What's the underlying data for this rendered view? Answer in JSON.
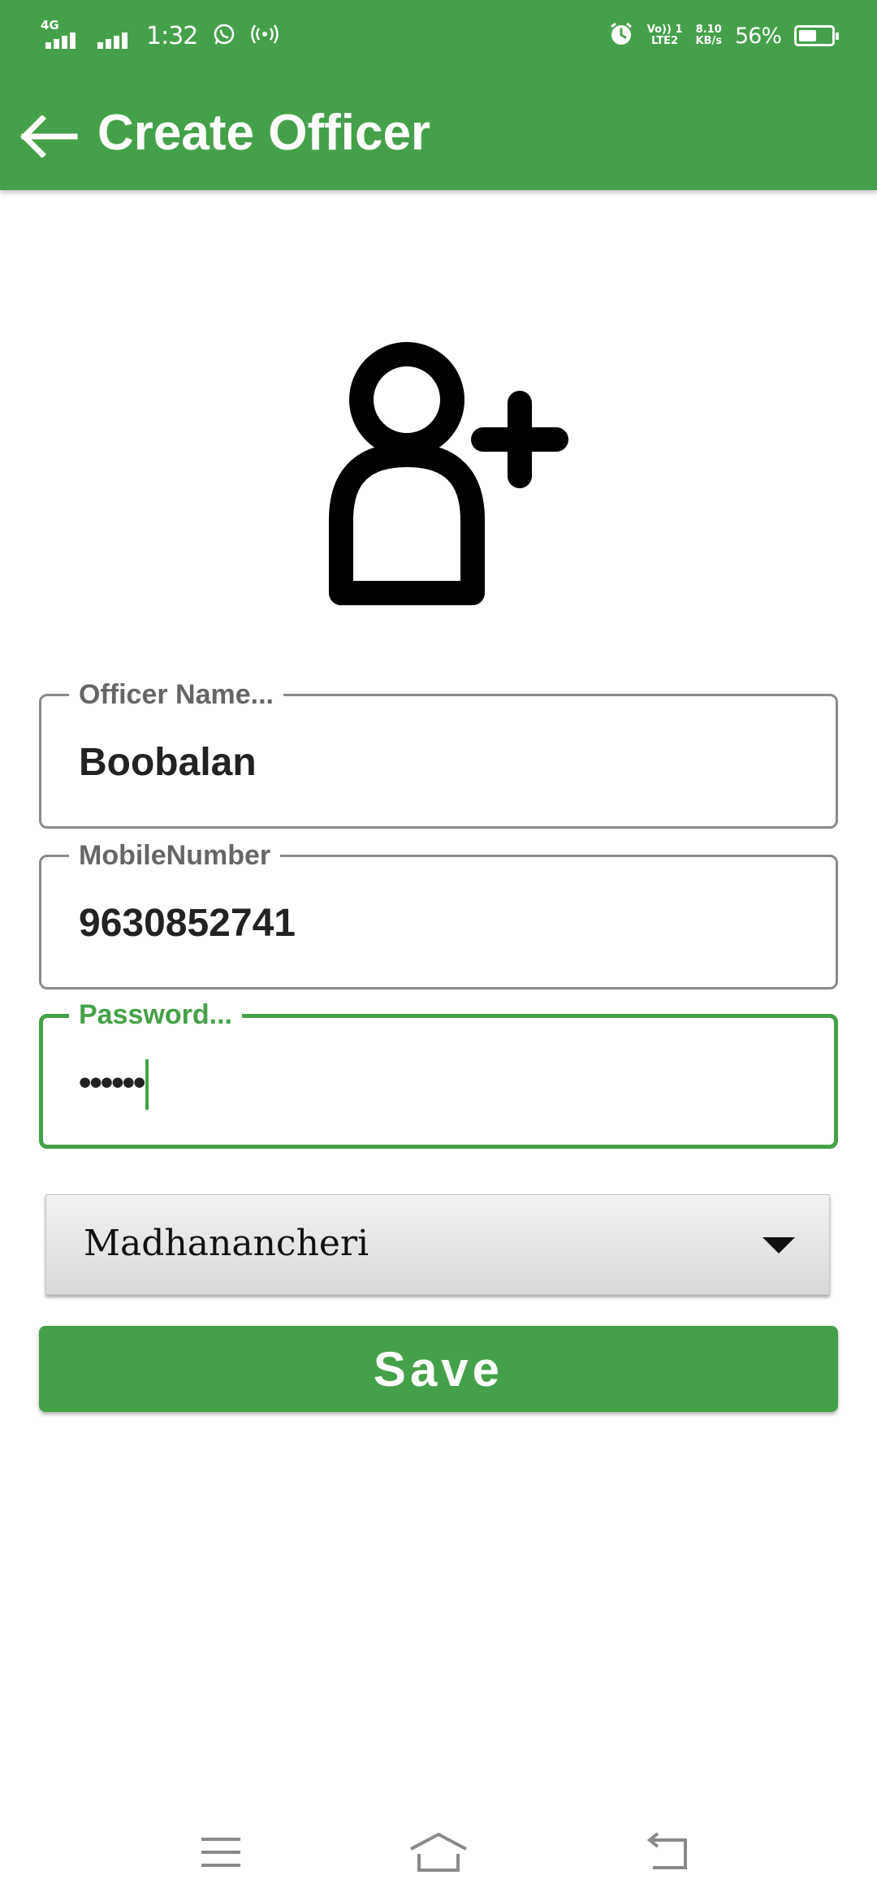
{
  "status_bar": {
    "network_tag": "4G",
    "time": "1:32",
    "volte_label": "Vo)) 1",
    "lte_label": "LTE2",
    "speed_value": "8.10",
    "speed_unit": "KB/s",
    "battery_percent": "56%",
    "battery_level": 0.56
  },
  "app_bar": {
    "title": "Create Officer",
    "background_color": "#45a149"
  },
  "form": {
    "officer_name": {
      "label": "Officer Name...",
      "value": "Boobalan"
    },
    "mobile_number": {
      "label": "MobileNumber",
      "value": "9630852741"
    },
    "password": {
      "label": "Password...",
      "value": "••••••",
      "focused": true
    },
    "area_select": {
      "selected": "Madhanancheri"
    },
    "save_button_label": "Save"
  },
  "icons": {
    "back": "arrow-left-icon",
    "avatar": "add-user-icon",
    "dropdown": "chevron-down-icon",
    "nav_menu": "menu-icon",
    "nav_home": "home-icon",
    "nav_back": "back-icon"
  },
  "colors": {
    "accent": "#45a149",
    "field_border": "#8a8a8a",
    "label_text": "#666666",
    "value_text": "#222222"
  }
}
